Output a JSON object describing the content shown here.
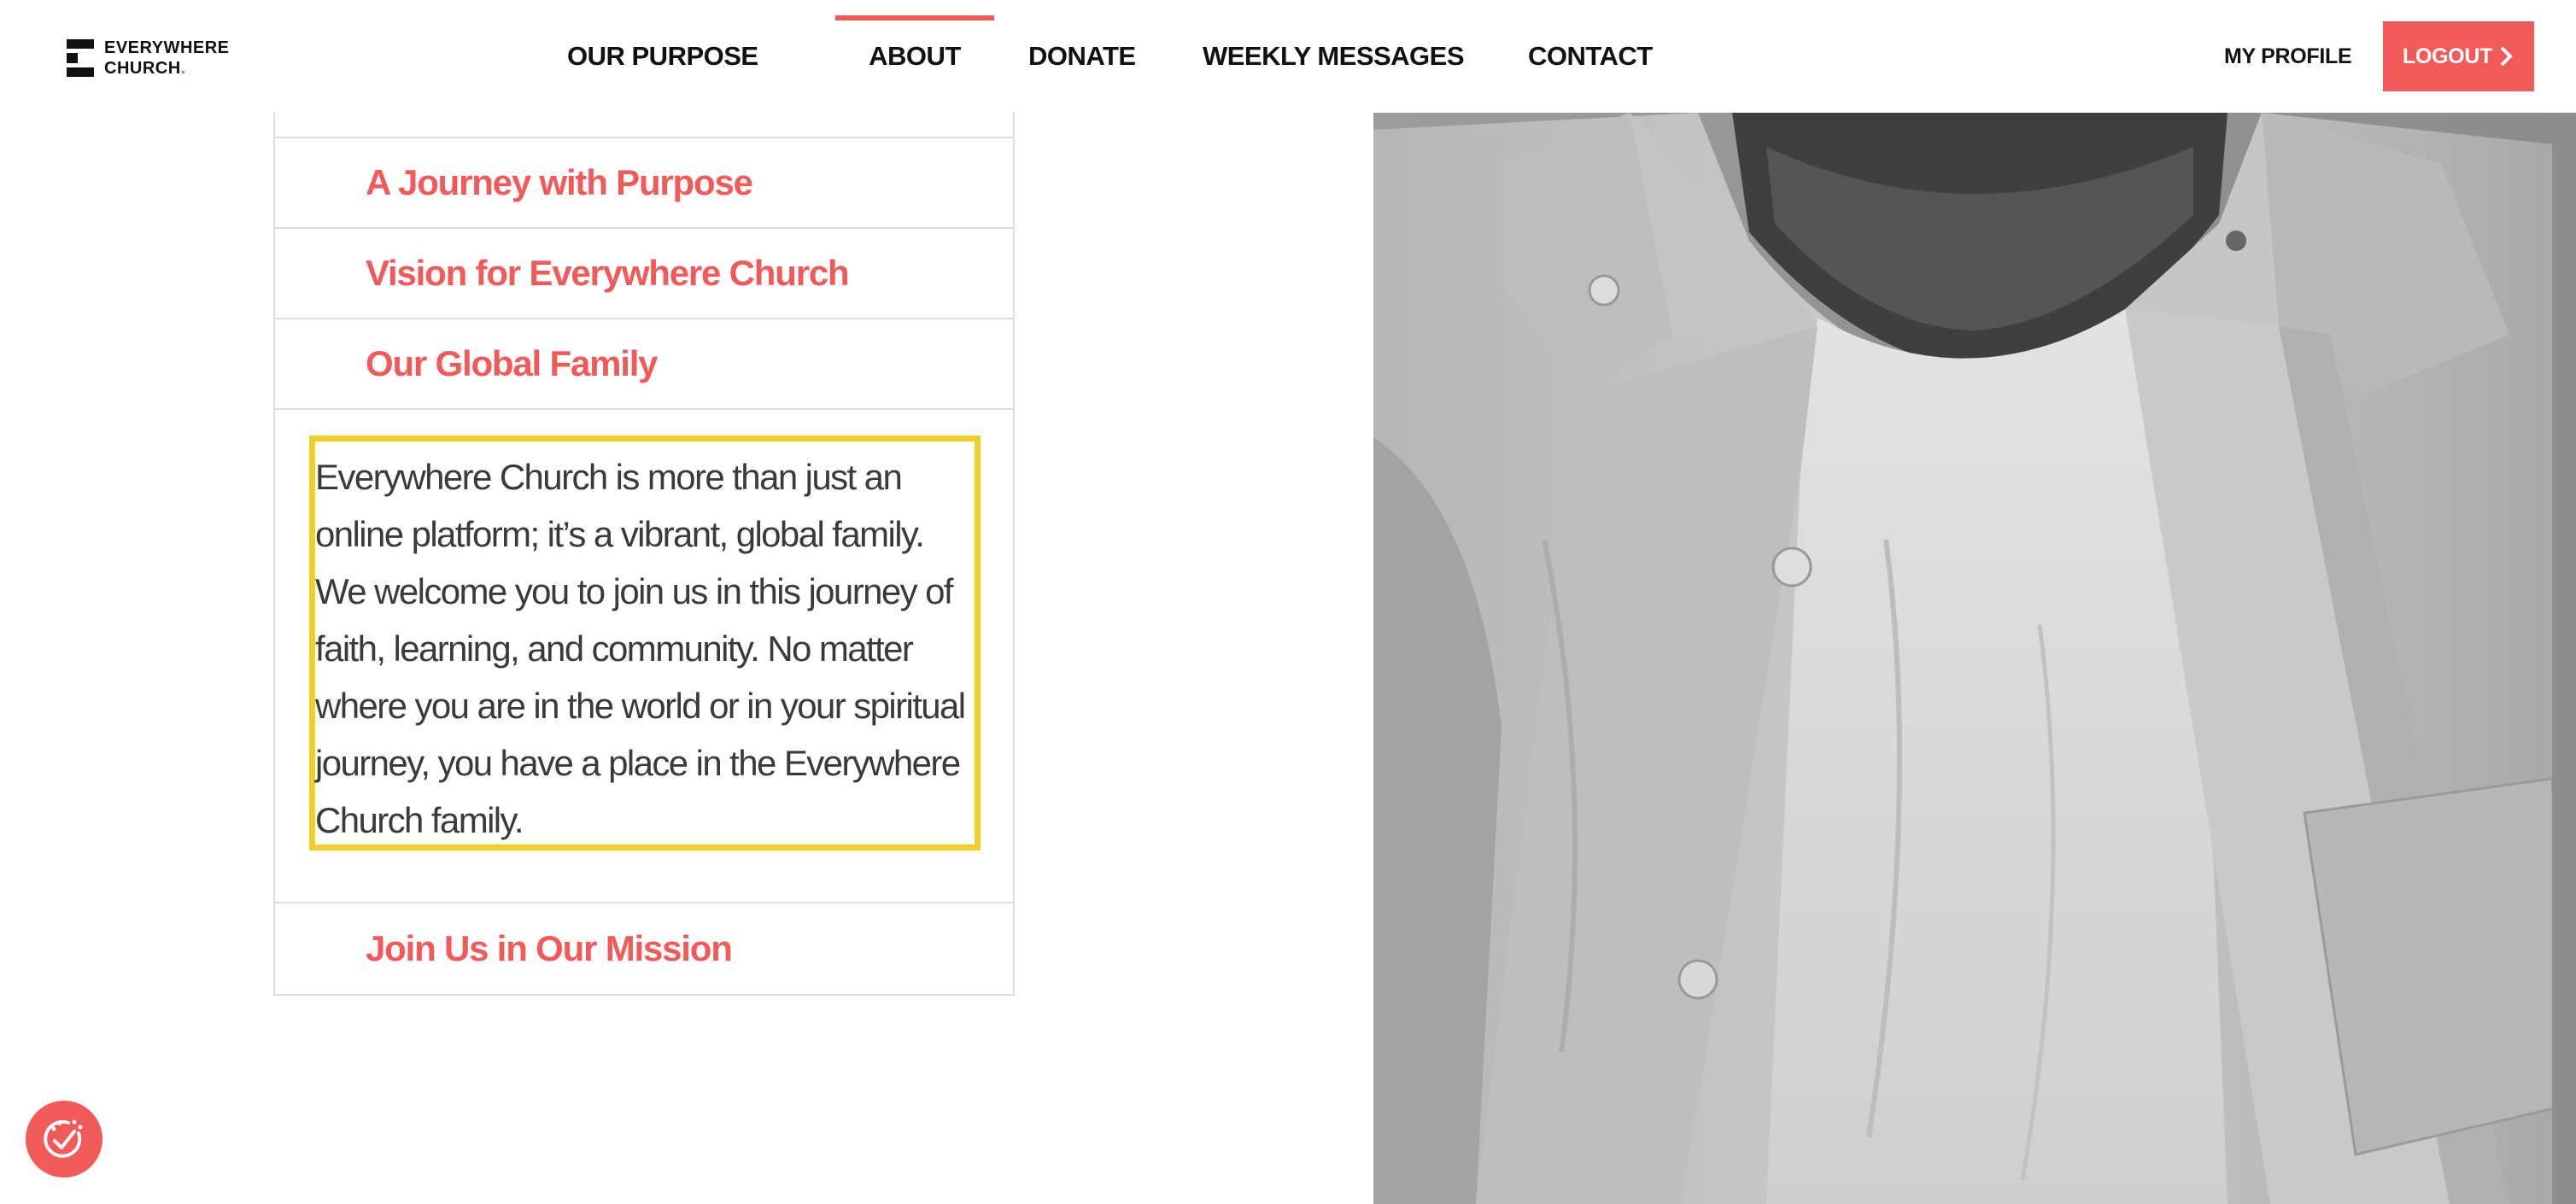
{
  "brand": {
    "line1": "EVERYWHERE",
    "line2": "CHURCH",
    "dot": ".",
    "accent_color": "#f25a5a"
  },
  "nav": {
    "items": [
      {
        "label": "OUR PURPOSE",
        "active": false
      },
      {
        "label": "ABOUT",
        "active": true
      },
      {
        "label": "DONATE",
        "active": false
      },
      {
        "label": "WEEKLY MESSAGES",
        "active": false
      },
      {
        "label": "CONTACT",
        "active": false
      }
    ],
    "my_profile": "MY PROFILE",
    "logout": "LOGOUT",
    "logout_icon": "chevron-right-icon"
  },
  "accordion": {
    "items": [
      {
        "title": "A Journey with Purpose",
        "expanded": false
      },
      {
        "title": "Vision for Everywhere Church",
        "expanded": false
      },
      {
        "title": "Our Global Family",
        "expanded": true
      },
      {
        "title": "Join Us in Our Mission",
        "expanded": false
      }
    ],
    "expanded_text": "Everywhere Church is more than just an online platform; it’s a vibrant, global family. We welcome you to join us in this journey of faith, learning, and community. No matter where you are in the world or in your spiritual journey, you have a place in the Everywhere Church family.",
    "highlight_color": "#f1cf2a"
  },
  "photo": {
    "subject": "person-in-light-shirt-photo",
    "style": "grayscale"
  },
  "cookie_badge": {
    "icon": "cookie-settings-icon"
  }
}
